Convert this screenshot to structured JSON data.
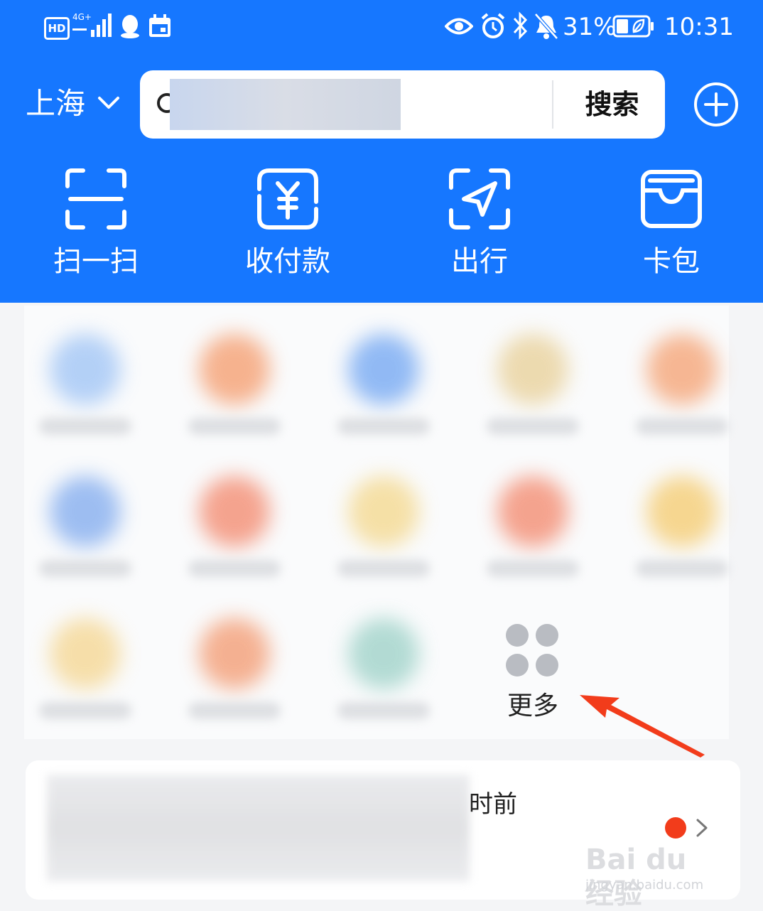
{
  "status_bar": {
    "hd_badge": "HD",
    "network": "4G+",
    "battery_percent": "31%",
    "time": "10:31"
  },
  "header": {
    "city": "上海",
    "search_placeholder": "",
    "search_button": "搜索"
  },
  "quick_actions": [
    {
      "label": "扫一扫",
      "icon": "scan-icon"
    },
    {
      "label": "收付款",
      "icon": "payment-icon"
    },
    {
      "label": "出行",
      "icon": "travel-icon"
    },
    {
      "label": "卡包",
      "icon": "card-wallet-icon"
    }
  ],
  "apps": {
    "blob_colors": [
      "#9cc2f5",
      "#f59a6a",
      "#6ea4f2",
      "#e8cf96",
      "#f5a070",
      "#7ea9ee",
      "#f3866a",
      "#f4d78a",
      "#f3866a",
      "#f5ca6c",
      "#f5d58e",
      "#f3986e",
      "#9ad0c6"
    ],
    "more_label": "更多"
  },
  "notice": {
    "time_suffix": "时前"
  },
  "watermark": {
    "brand": "Bai du 经验",
    "url": "jingyan.baidu.com"
  },
  "colors": {
    "brand_blue": "#1677ff",
    "arrow_red": "#f23c1b",
    "more_gray": "#b9bcc2"
  }
}
